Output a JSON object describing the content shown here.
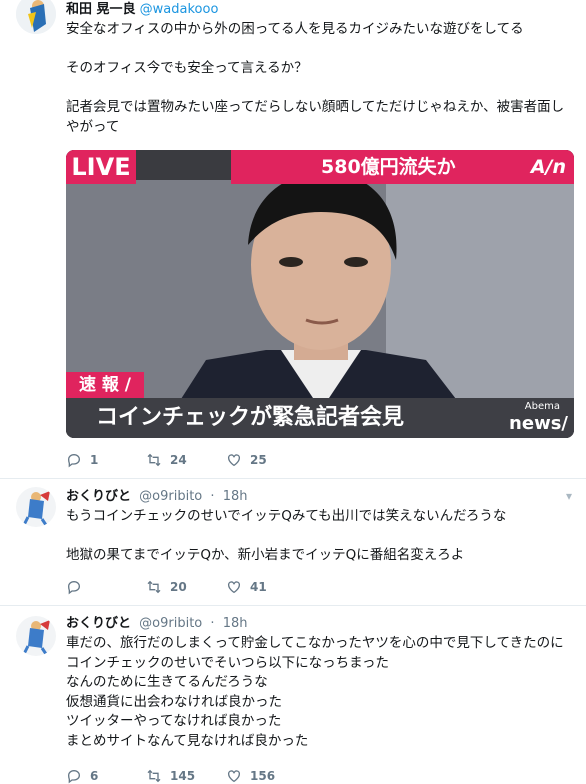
{
  "tweets": [
    {
      "name": "和田 晃一良",
      "handle": "@wadakooo",
      "text": "安全なオフィスの中から外の困ってる人を見るカイジみたいな遊びをしてる\n\nそのオフィス今でも安全って言えるか？\n\n記者会見では置物みたい座ってだらしない顔晒してただけじゃねえか、被害者面しやがって",
      "media": {
        "live_label": "LIVE",
        "headline": "580億円流失か",
        "brand": "A/n",
        "breaking_label": "速 報 /",
        "caption": "コインチェックが緊急記者会見",
        "brand_top": "Abema",
        "brand_bottom": "news/"
      },
      "replies": "1",
      "retweets": "24",
      "likes": "25"
    },
    {
      "name": "おくりびと",
      "handle": "@o9ribito",
      "time": "18h",
      "text": "もうコインチェックのせいでイッテQみても出川では笑えないんだろうな\n\n地獄の果てまでイッテQか、新小岩までイッテQに番組名変えろよ",
      "replies": "",
      "retweets": "20",
      "likes": "41"
    },
    {
      "name": "おくりびと",
      "handle": "@o9ribito",
      "time": "18h",
      "text": "車だの、旅行だのしまくって貯金してこなかったヤツを心の中で見下してきたのにコインチェックのせいでそいつら以下になっちまった\nなんのために生きてるんだろうな\n仮想通貨に出会わなければ良かった\nツイッターやってなければ良かった\nまとめサイトなんて見なければ良かった",
      "replies": "6",
      "retweets": "145",
      "likes": "156"
    }
  ],
  "colors": {
    "accent": "#e0245e",
    "link": "#1b95e0",
    "muted": "#657786",
    "divider": "#e6ecf0"
  }
}
